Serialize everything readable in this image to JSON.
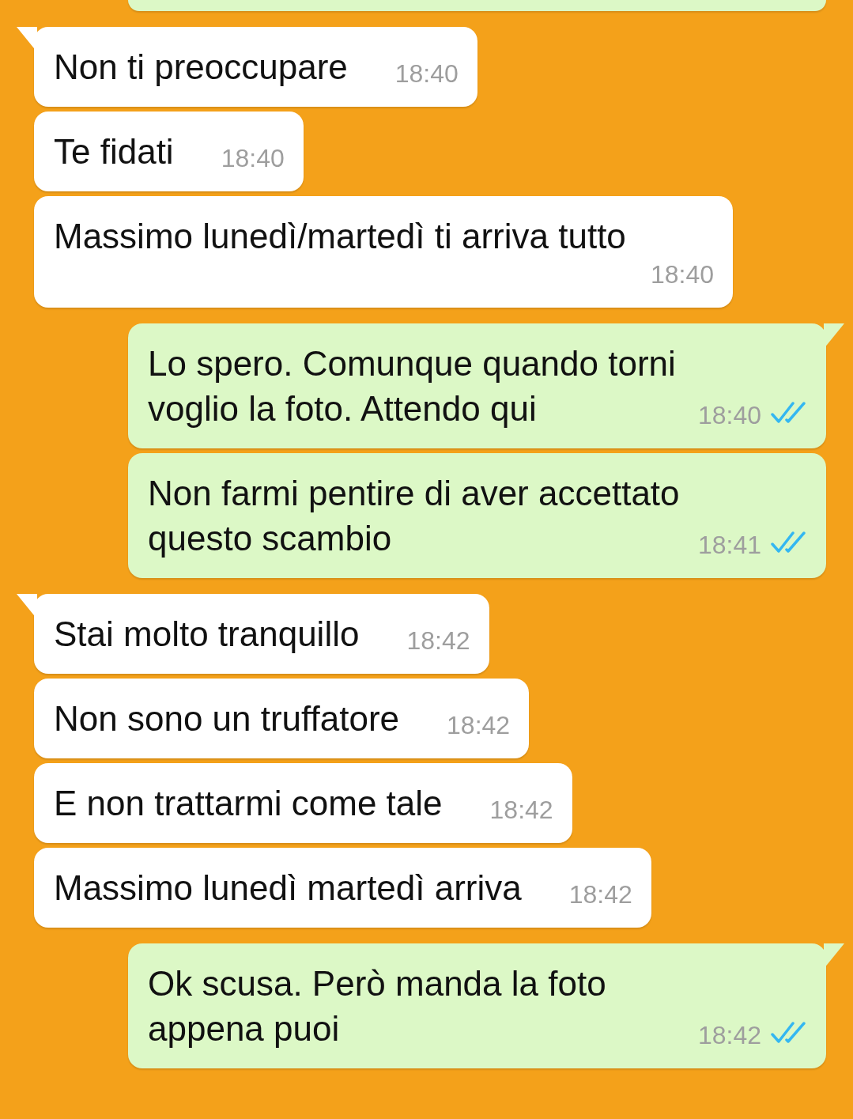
{
  "messages": [
    {
      "kind": "incoming",
      "tail": true,
      "text": "Non ti preoccupare",
      "time": "18:40"
    },
    {
      "kind": "incoming",
      "tail": false,
      "text": "Te fidati",
      "time": "18:40"
    },
    {
      "kind": "incoming",
      "tail": false,
      "text": "Massimo lunedì/martedì ti arriva tutto",
      "time": "18:40"
    },
    {
      "kind": "outgoing",
      "tail": true,
      "text": "Lo spero. Comunque quando torni voglio la foto. Attendo qui",
      "time": "18:40",
      "read": true
    },
    {
      "kind": "outgoing",
      "tail": false,
      "text": "Non farmi pentire di aver accettato questo scambio",
      "time": "18:41",
      "read": true
    },
    {
      "kind": "incoming",
      "tail": true,
      "text": "Stai molto tranquillo",
      "time": "18:42"
    },
    {
      "kind": "incoming",
      "tail": false,
      "text": "Non sono un truffatore",
      "time": "18:42"
    },
    {
      "kind": "incoming",
      "tail": false,
      "text": "E non trattarmi come tale",
      "time": "18:42"
    },
    {
      "kind": "incoming",
      "tail": false,
      "text": "Massimo lunedì martedì arriva",
      "time": "18:42"
    },
    {
      "kind": "outgoing",
      "tail": true,
      "text": "Ok scusa. Però manda la foto appena puoi",
      "time": "18:42",
      "read": true
    }
  ]
}
